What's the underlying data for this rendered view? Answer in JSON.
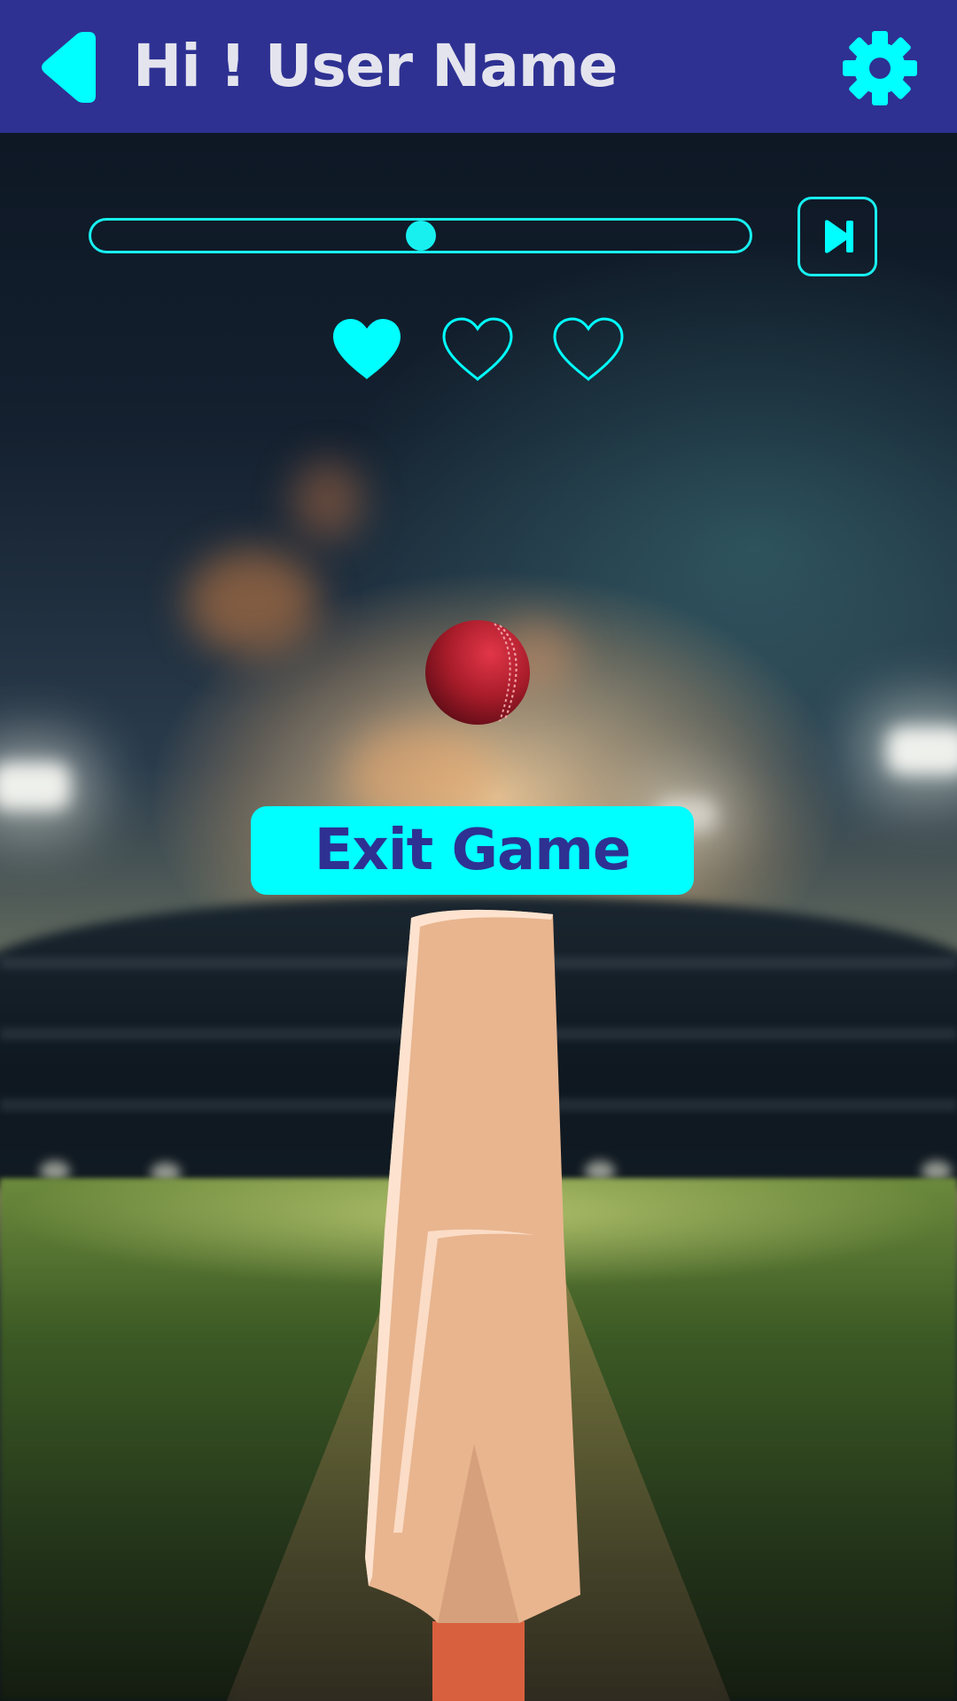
{
  "header": {
    "title": "Hi ! User Name",
    "background_color": "#2e3192",
    "back_icon": "back-arrow-icon",
    "settings_icon": "gear-icon"
  },
  "game": {
    "progress": 0.5,
    "skip_icon": "skip-forward-icon",
    "lives": {
      "total": 3,
      "remaining": 1,
      "icon": "heart-icon"
    },
    "ball_icon": "cricket-ball-icon",
    "bat_icon": "cricket-bat-icon"
  },
  "exit_button": {
    "label": "Exit Game"
  },
  "colors": {
    "accent": "#00ffff",
    "brand": "#2e3192",
    "title_text": "#e4e4ee",
    "ball": "#b8202e",
    "bat": "#e8b58f",
    "bat_handle": "#d9603f"
  }
}
